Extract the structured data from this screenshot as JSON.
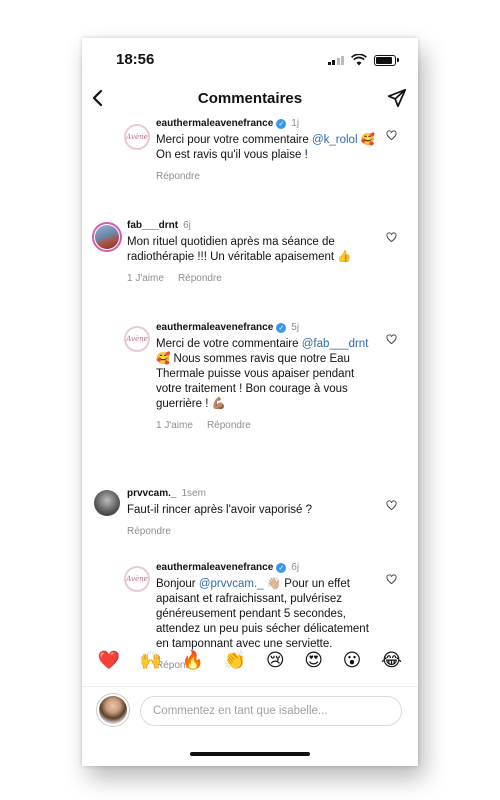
{
  "status": {
    "time": "18:56",
    "battery_level": 0.9
  },
  "header": {
    "title": "Commentaires"
  },
  "comments": [
    {
      "username": "eauthermaleavenefrance",
      "verified": true,
      "time": "1j",
      "text_parts": [
        "Merci pour votre commentaire ",
        "@k_rolol",
        " 🥰 On est ravis qu'il vous plaise !"
      ],
      "actions": {
        "likes": "",
        "reply": "Répondre"
      }
    },
    {
      "username": "fab___drnt",
      "verified": false,
      "time": "6j",
      "text_parts": [
        "Mon rituel quotidien après ma séance de radiothérapie !!! Un véritable apaisement 👍"
      ],
      "actions": {
        "likes": "1 J'aime",
        "reply": "Répondre"
      }
    },
    {
      "username": "eauthermaleavenefrance",
      "verified": true,
      "time": "5j",
      "text_parts": [
        "Merci de votre commentaire ",
        "@fab___drnt",
        " 🥰 Nous sommes ravis que notre Eau Thermale puisse vous apaiser pendant votre traitement ! Bon courage à vous guerrière ! 💪🏽"
      ],
      "actions": {
        "likes": "1 J'aime",
        "reply": "Répondre"
      }
    },
    {
      "username": "prvvcam._",
      "verified": false,
      "time": "1sem",
      "text_parts": [
        "Faut-il rincer après l'avoir vaporisé ?"
      ],
      "actions": {
        "likes": "",
        "reply": "Répondre"
      }
    },
    {
      "username": "eauthermaleavenefrance",
      "verified": true,
      "time": "6j",
      "text_parts": [
        "Bonjour ",
        "@prvvcam._",
        " 👋🏼 Pour un effet apaisant et rafraichissant, pulvérisez généreusement pendant 5 secondes, attendez un peu puis sécher délicatement en tamponnant avec une serviette."
      ],
      "actions": {
        "likes": "",
        "reply": "Répondre"
      }
    }
  ],
  "brand_avatar_text": "Avène",
  "emoji_bar": [
    "❤️",
    "🙌",
    "🔥",
    "👏",
    "😢",
    "😍",
    "😮",
    "😂"
  ],
  "composer": {
    "placeholder": "Commentez en tant que isabelle..."
  },
  "icons": {
    "back": "chevron-left-icon",
    "send": "send-icon",
    "heart": "heart-outline-icon",
    "verified": "verified-badge-icon"
  }
}
